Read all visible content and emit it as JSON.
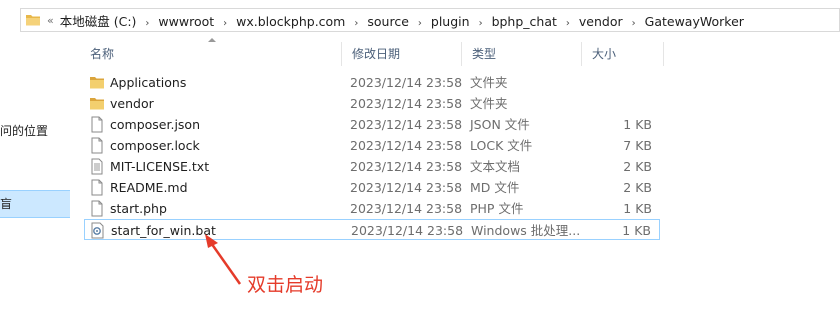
{
  "address": {
    "chevron": "«",
    "crumbs": [
      "本地磁盘 (C:)",
      "wwwroot",
      "wx.blockphp.com",
      "source",
      "plugin",
      "bphp_chat",
      "vendor",
      "GatewayWorker"
    ],
    "separator": "›"
  },
  "nav": {
    "partial_item": "问的位置",
    "selected_item": "盲"
  },
  "columns": {
    "name": "名称",
    "date": "修改日期",
    "type": "类型",
    "size": "大小"
  },
  "files": [
    {
      "name": "Applications",
      "date": "2023/12/14 23:58",
      "type": "文件夹",
      "size": "",
      "icon": "folder-icon"
    },
    {
      "name": "vendor",
      "date": "2023/12/14 23:58",
      "type": "文件夹",
      "size": "",
      "icon": "folder-icon"
    },
    {
      "name": "composer.json",
      "date": "2023/12/14 23:58",
      "type": "JSON 文件",
      "size": "1 KB",
      "icon": "document-icon"
    },
    {
      "name": "composer.lock",
      "date": "2023/12/14 23:58",
      "type": "LOCK 文件",
      "size": "7 KB",
      "icon": "document-icon"
    },
    {
      "name": "MIT-LICENSE.txt",
      "date": "2023/12/14 23:58",
      "type": "文本文档",
      "size": "2 KB",
      "icon": "text-document-icon"
    },
    {
      "name": "README.md",
      "date": "2023/12/14 23:58",
      "type": "MD 文件",
      "size": "2 KB",
      "icon": "document-icon"
    },
    {
      "name": "start.php",
      "date": "2023/12/14 23:58",
      "type": "PHP 文件",
      "size": "1 KB",
      "icon": "document-icon"
    },
    {
      "name": "start_for_win.bat",
      "date": "2023/12/14 23:58",
      "type": "Windows 批处理...",
      "size": "1 KB",
      "icon": "batch-file-icon"
    }
  ],
  "annotation": {
    "text": "双击启动",
    "color": "#e53b2a"
  },
  "colors": {
    "selection_border": "#99d1ff",
    "folder": "#e8b84a"
  }
}
